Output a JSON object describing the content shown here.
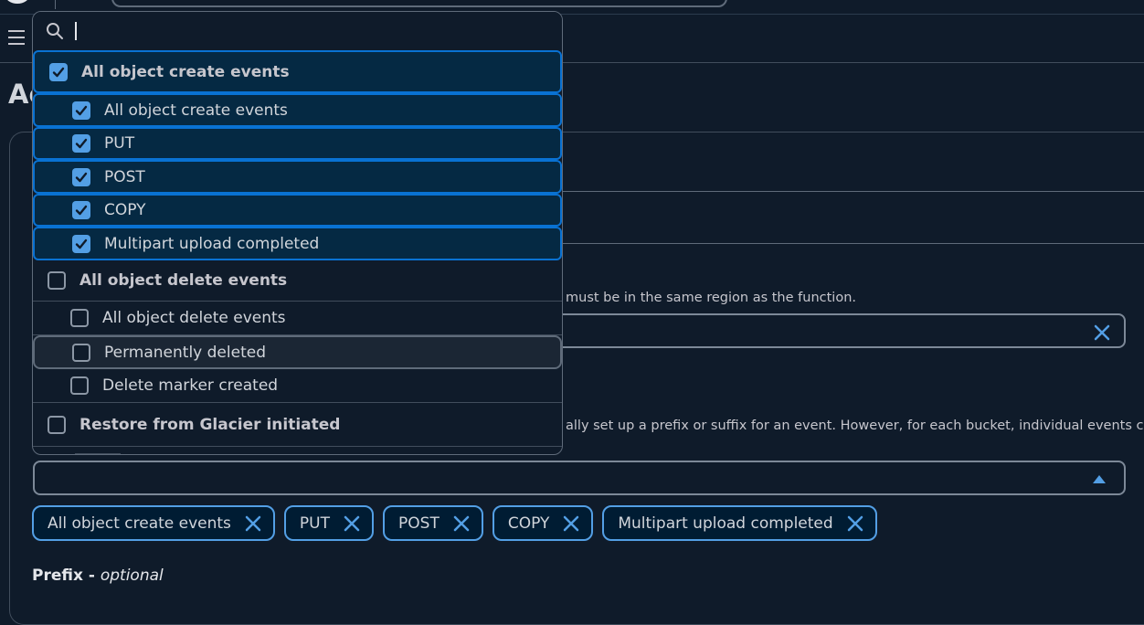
{
  "dropdown": {
    "search_value": "",
    "options": [
      {
        "label": "All object create events",
        "type": "group",
        "checked": true
      },
      {
        "label": "All object create events",
        "type": "child",
        "checked": true
      },
      {
        "label": "PUT",
        "type": "child",
        "checked": true
      },
      {
        "label": "POST",
        "type": "child",
        "checked": true
      },
      {
        "label": "COPY",
        "type": "child",
        "checked": true
      },
      {
        "label": "Multipart upload completed",
        "type": "child",
        "checked": true
      },
      {
        "label": "All object delete events",
        "type": "group",
        "checked": false
      },
      {
        "label": "All object delete events",
        "type": "child",
        "checked": false
      },
      {
        "label": "Permanently deleted",
        "type": "child",
        "checked": false
      },
      {
        "label": "Delete marker created",
        "type": "child",
        "checked": false
      },
      {
        "label": "Restore from Glacier initiated",
        "type": "group",
        "checked": false
      }
    ]
  },
  "background": {
    "heading_fragment": "Ac",
    "region_note_fragment": "must be in the same region as the function.",
    "prefix_note_fragment": "ally set up a prefix or suffix for an event. However, for each bucket, individual events cannot"
  },
  "tokens": [
    {
      "label": "All object create events"
    },
    {
      "label": "PUT"
    },
    {
      "label": "POST"
    },
    {
      "label": "COPY"
    },
    {
      "label": "Multipart upload completed"
    }
  ],
  "prefix": {
    "label": "Prefix - ",
    "optional": "optional"
  },
  "colors": {
    "accent": "#539fe5",
    "selected_bg": "#052943",
    "selected_border": "#0972d3",
    "page_bg": "#0f1b2a"
  }
}
